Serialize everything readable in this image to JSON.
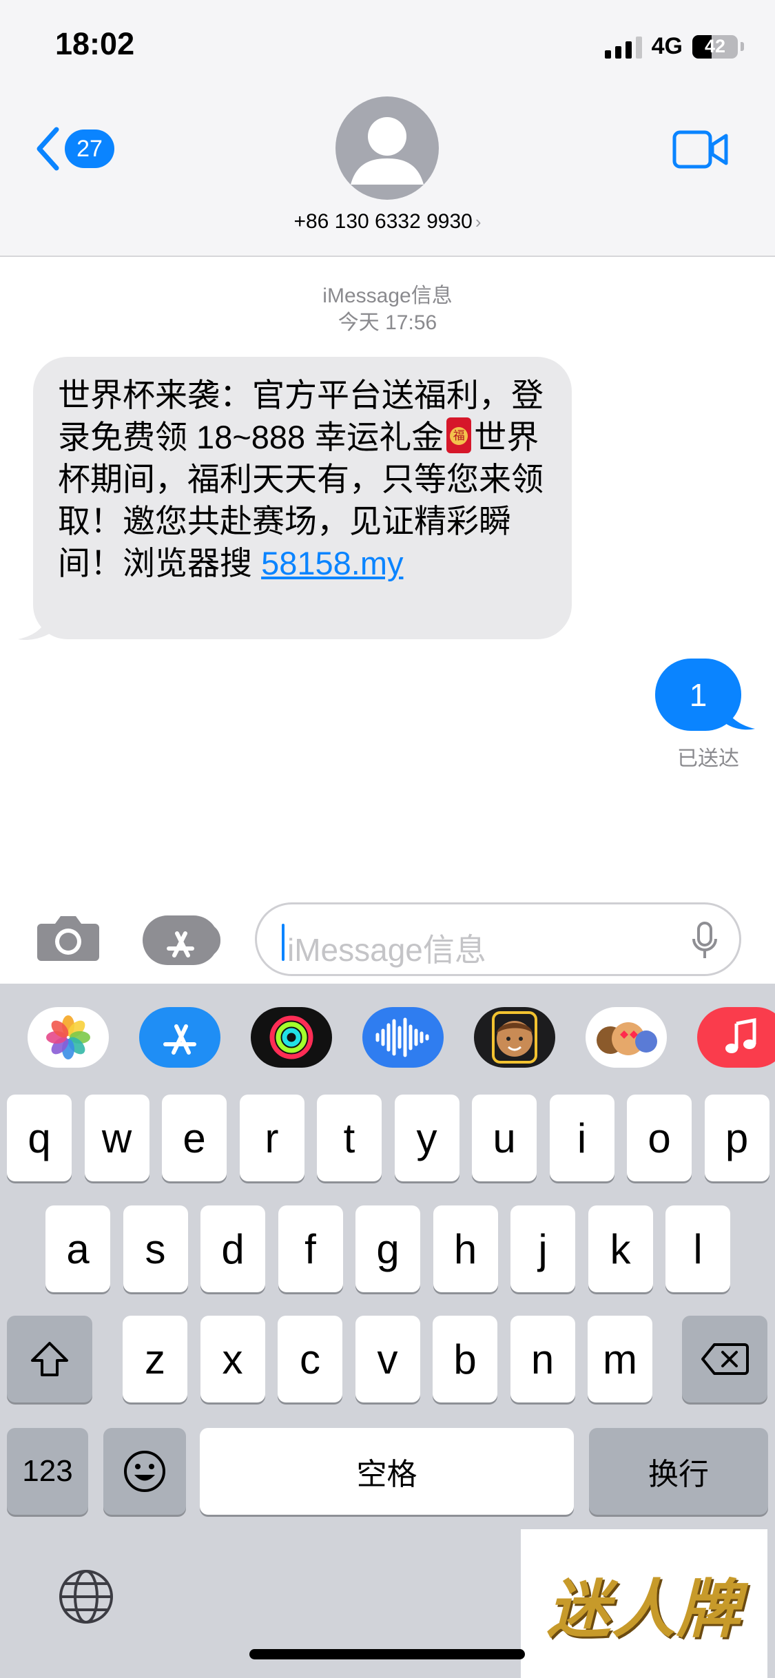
{
  "status_bar": {
    "time": "18:02",
    "network": "4G",
    "battery": "42",
    "battery_level": 0.42
  },
  "nav": {
    "unread_count": "27",
    "contact": "+86 130 6332 9930",
    "chevron": "›"
  },
  "transcript": {
    "service": "iMessage信息",
    "timestamp": "今天 17:56",
    "incoming": {
      "part1": "世界杯来袭：官方平台送福利，登录免费领 18~888 幸运礼金",
      "emoji_char": "福",
      "part2": "世界杯期间，福利天天有，只等您来领取！邀您共赴赛场，见证精彩瞬间！浏览器搜 ",
      "link": "58158.my"
    },
    "outgoing": {
      "text": "1",
      "status": "已送达"
    }
  },
  "compose": {
    "placeholder": "iMessage信息"
  },
  "app_drawer": [
    "photos-icon",
    "app-store-icon",
    "activity-icon",
    "audio-message-icon",
    "memoji-icon",
    "memoji-stickers-icon",
    "music-icon"
  ],
  "keyboard": {
    "row1": [
      "q",
      "w",
      "e",
      "r",
      "t",
      "y",
      "u",
      "i",
      "o",
      "p"
    ],
    "row2": [
      "a",
      "s",
      "d",
      "f",
      "g",
      "h",
      "j",
      "k",
      "l"
    ],
    "row3": [
      "z",
      "x",
      "c",
      "v",
      "b",
      "n",
      "m"
    ],
    "numbers": "123",
    "space": "空格",
    "return": "换行"
  },
  "watermark": "迷人牌",
  "colors": {
    "accent": "#0a84ff",
    "incoming_bubble": "#e9e9eb",
    "keyboard_bg": "#d1d3d9"
  }
}
